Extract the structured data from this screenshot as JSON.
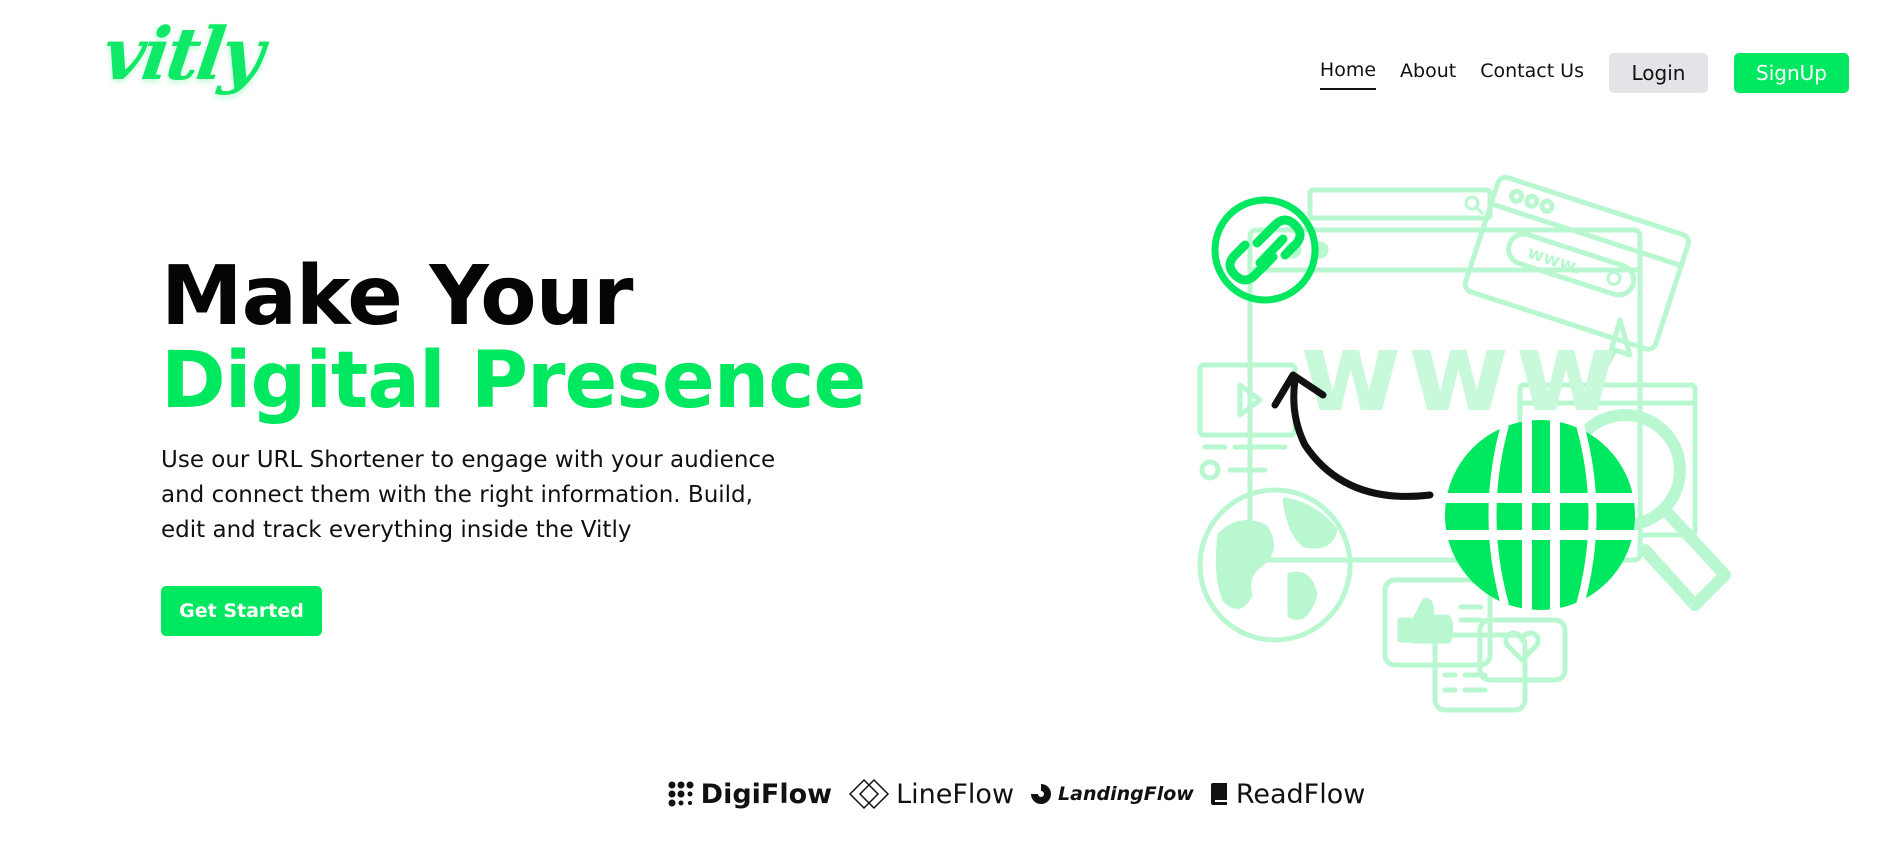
{
  "brand": {
    "logo_text": "vitly"
  },
  "nav": {
    "links": [
      {
        "label": "Home",
        "active": true
      },
      {
        "label": "About",
        "active": false
      },
      {
        "label": "Contact Us",
        "active": false
      }
    ],
    "login_label": "Login",
    "signup_label": "SignUp"
  },
  "hero": {
    "title_line1": "Make Your",
    "title_line2": "Digital Presence",
    "description": "Use our URL Shortener to engage with your audience and connect them with the right information. Build, edit and track everything inside the Vitly",
    "cta_label": "Get Started"
  },
  "illustration": {
    "www_text": "www",
    "browser_www_text": "www."
  },
  "partners": [
    {
      "name": "DigiFlow",
      "icon": "digiflow-dots-icon"
    },
    {
      "name": "LineFlow",
      "icon": "lineflow-diamond-icon"
    },
    {
      "name": "LandingFlow",
      "icon": "landingflow-swirl-icon"
    },
    {
      "name": "ReadFlow",
      "icon": "readflow-book-icon"
    }
  ],
  "colors": {
    "accent": "#00e85f",
    "accent_light": "#b8f7d0",
    "login_bg": "#e2e4e7",
    "text": "#111111"
  }
}
